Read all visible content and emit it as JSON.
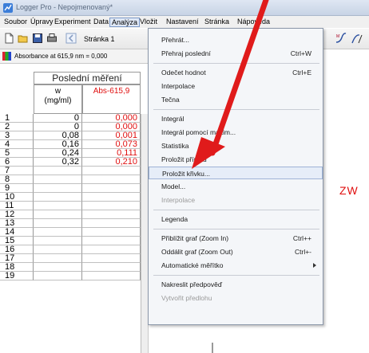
{
  "window": {
    "title": "Logger Pro - Nepojmenovaný*"
  },
  "menubar": [
    {
      "label": "Soubor",
      "active": false
    },
    {
      "label": "Úpravy",
      "active": false
    },
    {
      "label": "Experiment",
      "active": false
    },
    {
      "label": "Data",
      "active": false
    },
    {
      "label": "Analýza",
      "active": true
    },
    {
      "label": "Vložit",
      "active": false
    },
    {
      "label": "Nastavení",
      "active": false
    },
    {
      "label": "Stránka",
      "active": false
    },
    {
      "label": "Nápověda",
      "active": false
    }
  ],
  "toolbar": {
    "page_label": "Stránka 1"
  },
  "status": {
    "readout": "Absorbance at 615,9 nm = 0,000"
  },
  "table": {
    "group_header": "Poslední měření",
    "columns": [
      {
        "name": "w",
        "unit": "(mg/ml)"
      },
      {
        "name": "Abs-615,9",
        "unit": ""
      }
    ],
    "rows": [
      {
        "n": "1",
        "w": "0",
        "abs": "0,000"
      },
      {
        "n": "2",
        "w": "0",
        "abs": "0,000"
      },
      {
        "n": "3",
        "w": "0,08",
        "abs": "0,001"
      },
      {
        "n": "4",
        "w": "0,16",
        "abs": "0,073"
      },
      {
        "n": "5",
        "w": "0,24",
        "abs": "0,111"
      },
      {
        "n": "6",
        "w": "0,32",
        "abs": "0,210"
      },
      {
        "n": "7",
        "w": "",
        "abs": ""
      },
      {
        "n": "8",
        "w": "",
        "abs": ""
      },
      {
        "n": "9",
        "w": "",
        "abs": ""
      },
      {
        "n": "10",
        "w": "",
        "abs": ""
      },
      {
        "n": "11",
        "w": "",
        "abs": ""
      },
      {
        "n": "12",
        "w": "",
        "abs": ""
      },
      {
        "n": "13",
        "w": "",
        "abs": ""
      },
      {
        "n": "14",
        "w": "",
        "abs": ""
      },
      {
        "n": "15",
        "w": "",
        "abs": ""
      },
      {
        "n": "16",
        "w": "",
        "abs": ""
      },
      {
        "n": "17",
        "w": "",
        "abs": ""
      },
      {
        "n": "18",
        "w": "",
        "abs": ""
      },
      {
        "n": "19",
        "w": "",
        "abs": ""
      }
    ]
  },
  "menu": {
    "items": [
      {
        "label": "Přehrát...",
        "shortcut": ""
      },
      {
        "label": "Přehraj poslední",
        "shortcut": "Ctrl+W"
      },
      {
        "sep": true
      },
      {
        "label": "Odečet hodnot",
        "shortcut": "Ctrl+E"
      },
      {
        "label": "Interpolace",
        "shortcut": ""
      },
      {
        "label": "Tečna",
        "shortcut": ""
      },
      {
        "sep": true
      },
      {
        "label": "Integrál",
        "shortcut": ""
      },
      {
        "label": "Integrál pomocí maxim...",
        "shortcut": ""
      },
      {
        "label": "Statistika",
        "shortcut": ""
      },
      {
        "label": "Proložit přímku",
        "shortcut": ""
      },
      {
        "label": "Proložit křivku...",
        "shortcut": "",
        "highlight": true
      },
      {
        "label": "Model...",
        "shortcut": ""
      },
      {
        "label": "Interpolace",
        "shortcut": "",
        "disabled": true
      },
      {
        "sep": true
      },
      {
        "label": "Legenda",
        "shortcut": ""
      },
      {
        "sep": true
      },
      {
        "label": "Přiblížit graf (Zoom In)",
        "shortcut": "Ctrl++"
      },
      {
        "label": "Oddálit graf (Zoom Out)",
        "shortcut": "Ctrl+-"
      },
      {
        "label": "Automatické měřítko",
        "shortcut": "",
        "submenu": true
      },
      {
        "sep": true
      },
      {
        "label": "Nakreslit předpověď",
        "shortcut": ""
      },
      {
        "label": "Vytvořit předlohu",
        "shortcut": "",
        "disabled": true
      }
    ]
  },
  "overlay": {
    "text": "ZW"
  },
  "colors": {
    "accent_red": "#e01010",
    "menu_highlight": "#e6edf8"
  }
}
